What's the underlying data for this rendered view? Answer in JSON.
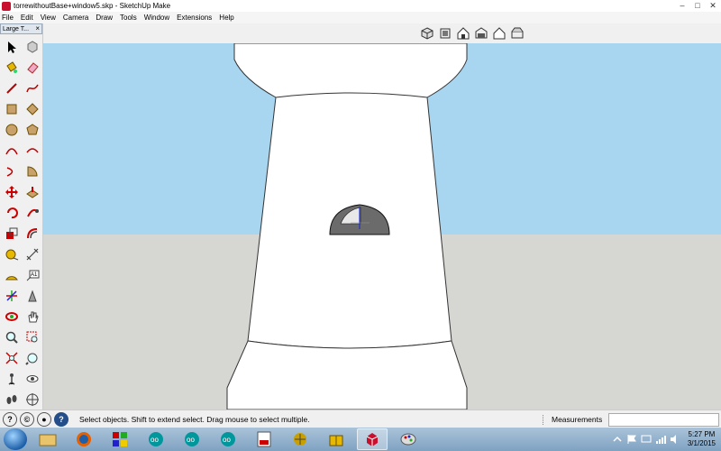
{
  "window": {
    "title": "torrewithoutBase+window5.skp - SketchUp Make",
    "controls": [
      "minimize",
      "maximize",
      "close"
    ]
  },
  "menu": [
    "File",
    "Edit",
    "View",
    "Camera",
    "Draw",
    "Tools",
    "Window",
    "Extensions",
    "Help"
  ],
  "views_toolbar": [
    "iso-view-icon",
    "top-view-icon",
    "front-view-icon",
    "right-view-icon",
    "back-view-icon",
    "left-view-icon"
  ],
  "palette": {
    "title": "Large T...",
    "close": "×"
  },
  "status": {
    "message": "Select objects. Shift to extend select. Drag mouse to select multiple.",
    "measurements_label": "Measurements",
    "measurements_value": ""
  },
  "taskbar": {
    "apps": [
      "windows-explorer",
      "firefox",
      "app-grid",
      "arduino",
      "arduino",
      "arduino",
      "pdf-reader",
      "network-app",
      "gift-app",
      "sketchup",
      "paint"
    ]
  },
  "clock": {
    "time": "5:27 PM",
    "date": "3/1/2015"
  },
  "colors": {
    "sky": "#a8d6f0",
    "ground": "#d6d6d2",
    "tower": "#ffffff",
    "window_fill": "#6b6b6b"
  }
}
